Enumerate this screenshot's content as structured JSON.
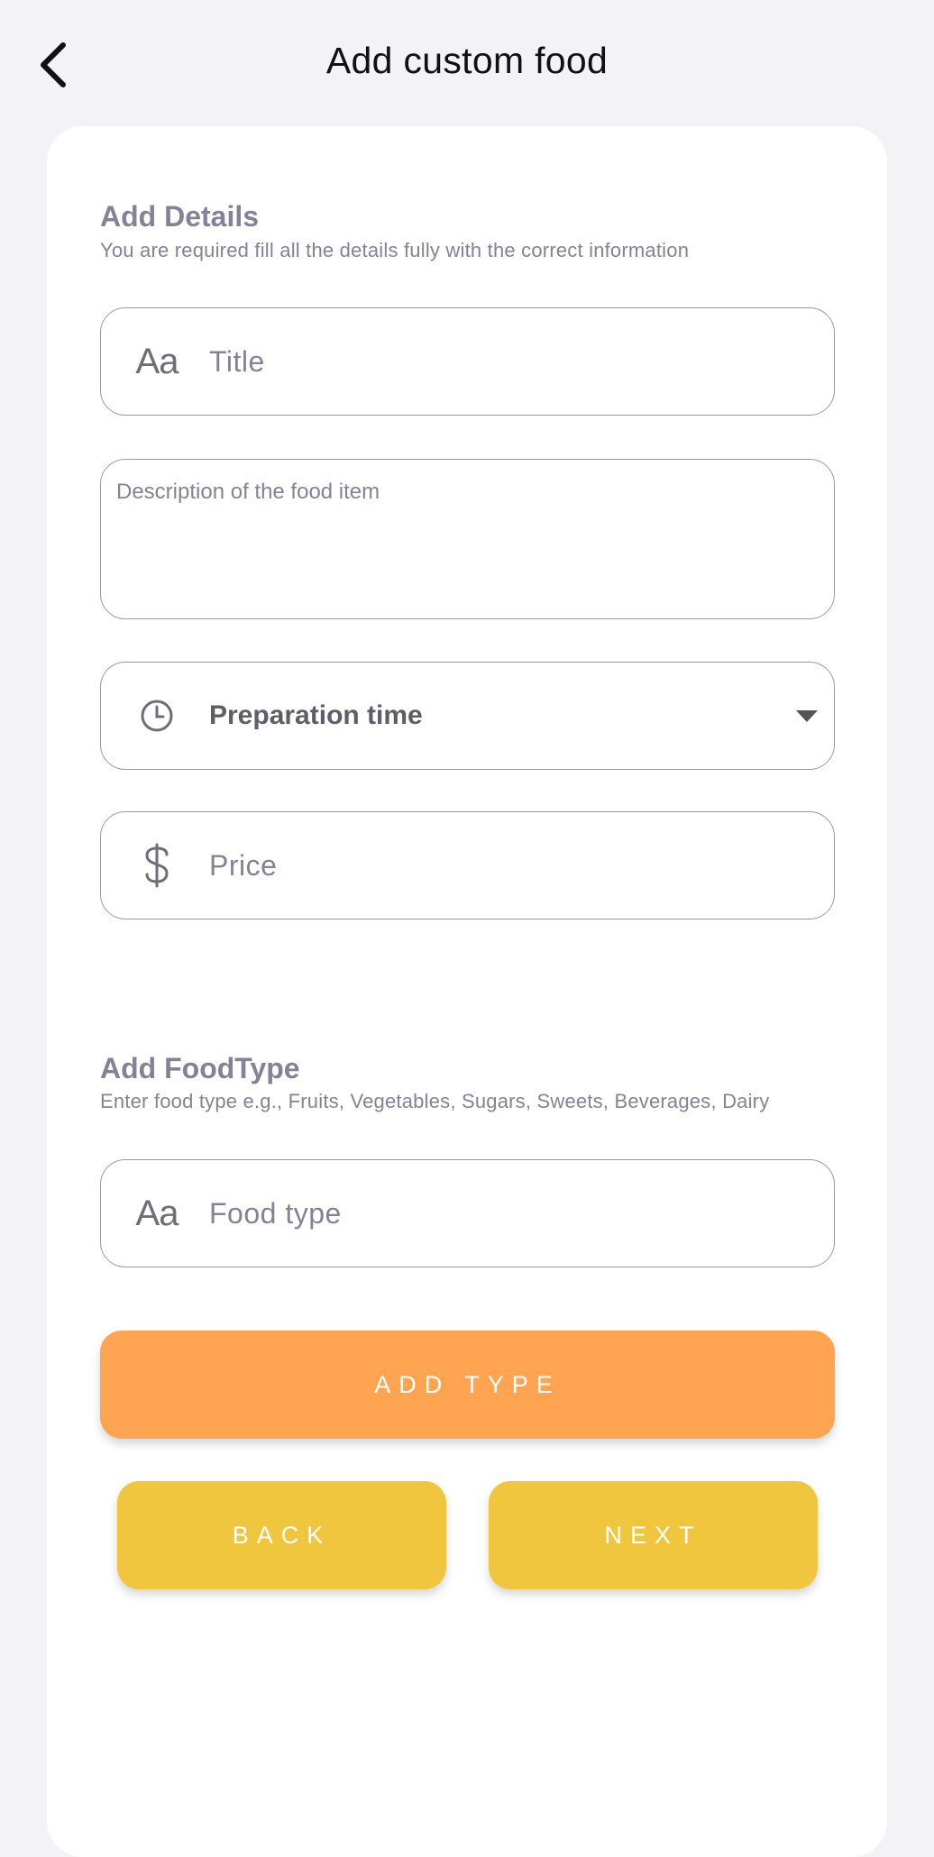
{
  "header": {
    "title": "Add custom food",
    "back_icon": "chevron-left-icon"
  },
  "details": {
    "title": "Add Details",
    "subtitle": "You are required fill all the details fully with the correct information",
    "title_field": {
      "icon": "text-aa-icon",
      "icon_text": "Aa",
      "placeholder": "Title"
    },
    "description_field": {
      "placeholder": "Description of the food item"
    },
    "prep_time_field": {
      "icon": "clock-icon",
      "label": "Preparation time",
      "caret": "dropdown-arrow-icon"
    },
    "price_field": {
      "icon": "dollar-icon",
      "placeholder": "Price"
    }
  },
  "food_type": {
    "title": "Add FoodType",
    "subtitle": "Enter food type e.g., Fruits, Vegetables, Sugars, Sweets, Beverages, Dairy",
    "field": {
      "icon": "text-aa-icon",
      "icon_text": "Aa",
      "placeholder": "Food type"
    }
  },
  "buttons": {
    "add_type": "ADD TYPE",
    "back": "BACK",
    "next": "NEXT"
  },
  "colors": {
    "background": "#f3f3f7",
    "card": "#ffffff",
    "muted_text": "#858297",
    "add_button": "#ffa552",
    "nav_button": "#f0c63f"
  }
}
